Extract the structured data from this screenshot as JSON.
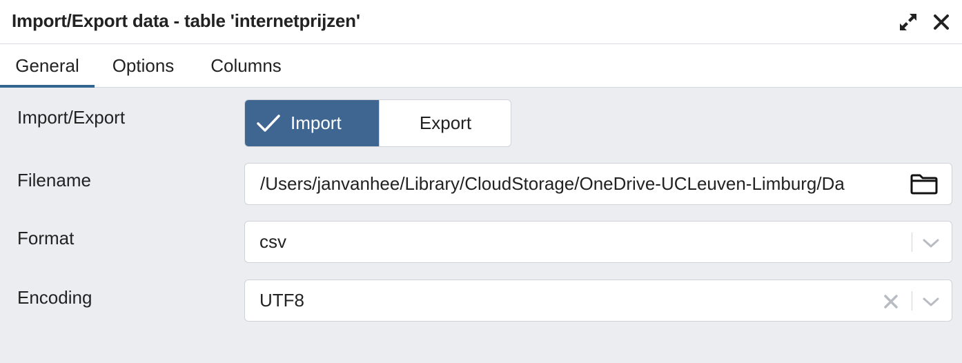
{
  "dialog": {
    "title": "Import/Export data - table 'internetprijzen'",
    "expand_icon": "expand-arrows-icon",
    "close_icon": "close-icon"
  },
  "tabs": [
    {
      "label": "General",
      "active": true
    },
    {
      "label": "Options",
      "active": false
    },
    {
      "label": "Columns",
      "active": false
    }
  ],
  "form": {
    "import_export": {
      "label": "Import/Export",
      "options": [
        "Import",
        "Export"
      ],
      "selected": "Import"
    },
    "filename": {
      "label": "Filename",
      "value": "/Users/janvanhee/Library/CloudStorage/OneDrive-UCLeuven-Limburg/Da"
    },
    "format": {
      "label": "Format",
      "value": "csv"
    },
    "encoding": {
      "label": "Encoding",
      "value": "UTF8"
    }
  },
  "colors": {
    "accent": "#326690",
    "toggle_active": "#3f6690",
    "background": "#ebedf1"
  }
}
